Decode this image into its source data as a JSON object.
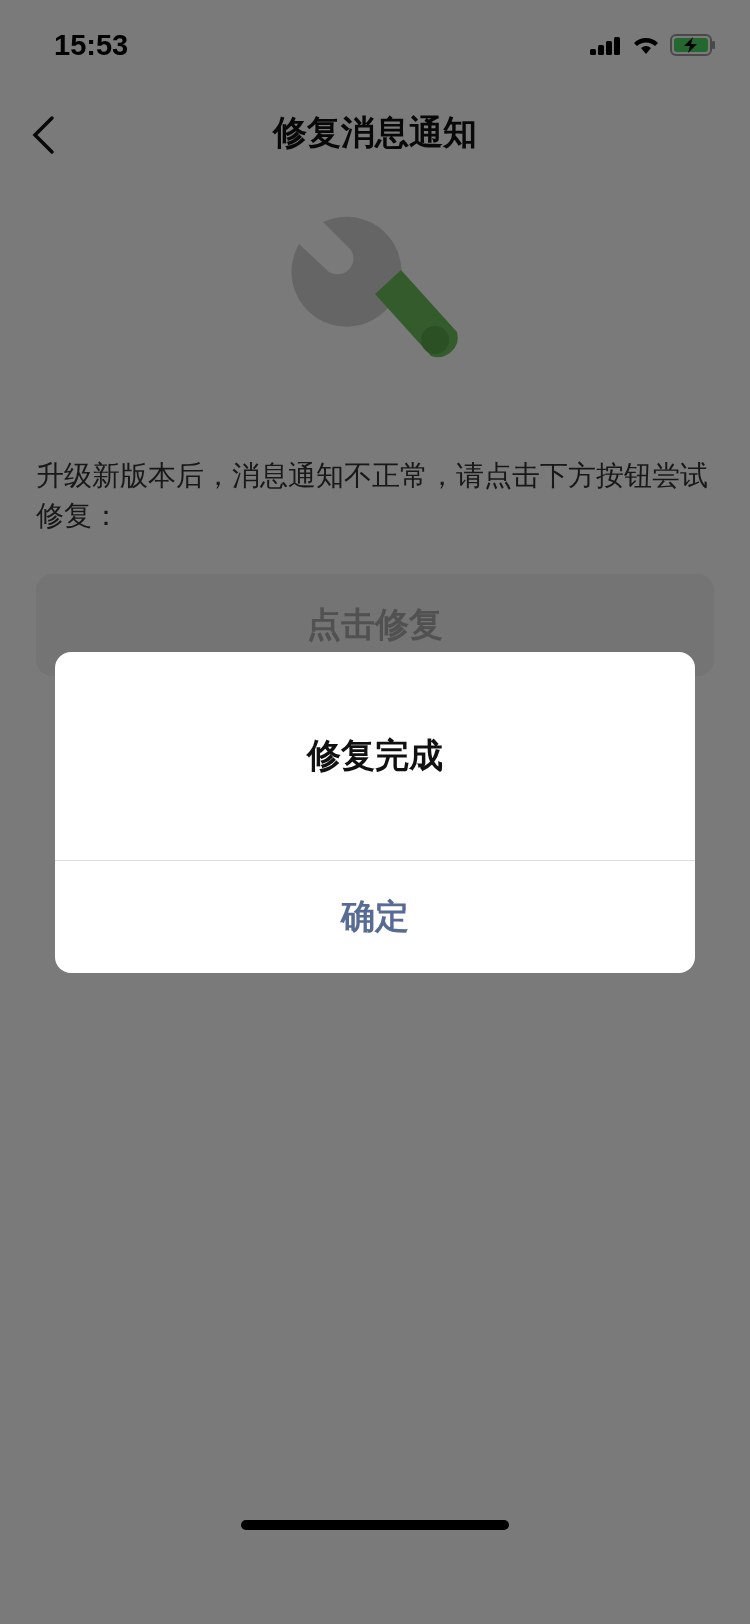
{
  "status_bar": {
    "time": "15:53"
  },
  "nav": {
    "title": "修复消息通知"
  },
  "description": "升级新版本后，消息通知不正常，请点击下方按钮尝试修复：",
  "repair_button": {
    "label": "点击修复"
  },
  "dialog": {
    "title": "修复完成",
    "confirm": "确定"
  }
}
